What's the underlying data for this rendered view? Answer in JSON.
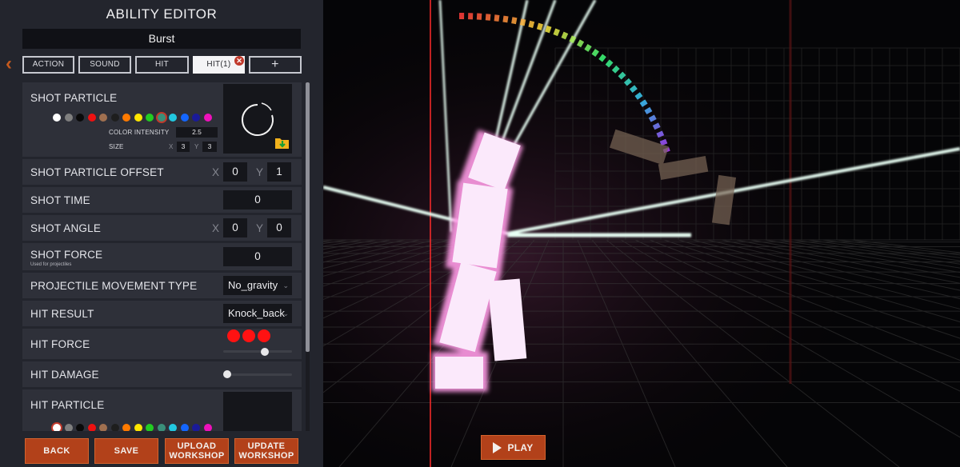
{
  "editor": {
    "title": "ABILITY EDITOR",
    "ability_name": "Burst",
    "tabs": [
      {
        "label": "ACTION"
      },
      {
        "label": "SOUND"
      },
      {
        "label": "HIT"
      },
      {
        "label": "HIT(1)",
        "active": true
      },
      {
        "label": "+"
      }
    ],
    "close_icon": "close-icon",
    "back_icon": "chevron-left-icon"
  },
  "palette": [
    "#ffffff",
    "#7f7f7f",
    "#0a0a0a",
    "#ee1111",
    "#a07050",
    "#1e1e1e",
    "#ff7a00",
    "#ffe600",
    "#22cc22",
    "#3a8f7a",
    "#22c8e0",
    "#1466ff",
    "#1a1a99",
    "#ee11bb"
  ],
  "shot_particle": {
    "label": "SHOT PARTICLE",
    "color_intensity_label": "COLOR INTENSITY",
    "color_intensity": "2.5",
    "size_label": "SIZE",
    "size_x": "3",
    "size_y": "3",
    "folder_icon": "folder-download-icon"
  },
  "shot_particle_offset": {
    "label": "SHOT PARTICLE OFFSET",
    "x": "0",
    "y": "1"
  },
  "shot_time": {
    "label": "SHOT TIME",
    "value": "0"
  },
  "shot_angle": {
    "label": "SHOT ANGLE",
    "x": "0",
    "y": "0"
  },
  "shot_force": {
    "label": "SHOT FORCE",
    "sub": "Used for projectiles",
    "value": "0"
  },
  "projectile_movement_type": {
    "label": "PROJECTILE MOVEMENT TYPE",
    "value": "No_gravity"
  },
  "hit_result": {
    "label": "HIT RESULT",
    "value": "Knock_back"
  },
  "hit_force": {
    "label": "HIT FORCE",
    "level": 0.62,
    "dots": 3
  },
  "hit_damage": {
    "label": "HIT DAMAGE",
    "level": 0.0
  },
  "hit_particle": {
    "label": "HIT PARTICLE"
  },
  "axis": {
    "x": "X",
    "y": "Y"
  },
  "buttons": {
    "back": "BACK",
    "save": "SAVE",
    "upload_workshop": "UPLOAD WORKSHOP",
    "update_workshop": "UPDATE WORKSHOP"
  },
  "play": {
    "label": "PLAY",
    "icon": "play-icon"
  },
  "colors": {
    "accent": "#b2411a",
    "panel": "#23252d",
    "row": "#2e3039",
    "field": "#15161b"
  }
}
